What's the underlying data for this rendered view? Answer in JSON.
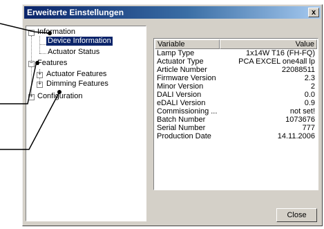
{
  "window": {
    "title": "Erweiterte Einstellungen",
    "close_glyph": "x",
    "close_icon": "close-icon"
  },
  "tree": {
    "information": {
      "label": "Information",
      "expander": "−"
    },
    "device_information": {
      "label": "Device Information",
      "selected": true
    },
    "actuator_status": {
      "label": "Actuator Status"
    },
    "features": {
      "label": "Features",
      "expander": "−"
    },
    "actuator_features": {
      "label": "Actuator Features",
      "expander": "+"
    },
    "dimming_features": {
      "label": "Dimming Features",
      "expander": "+"
    },
    "configuration": {
      "label": "Configuration",
      "expander": "+"
    }
  },
  "table": {
    "columns": [
      "Variable",
      "Value"
    ],
    "rows": [
      [
        "Lamp Type",
        "1x14W T16 (FH-FQ)"
      ],
      [
        "Actuator Type",
        "PCA EXCEL one4all lp"
      ],
      [
        "Article Number",
        "22088511"
      ],
      [
        "Firmware Version",
        "2.3"
      ],
      [
        "Minor Version",
        "2"
      ],
      [
        "DALI Version",
        "0.0"
      ],
      [
        "eDALI Version",
        "0.9"
      ],
      [
        "Commissioning ...",
        "not set!"
      ],
      [
        "Batch Number",
        "1073676"
      ],
      [
        "Serial Number",
        "777"
      ],
      [
        "Production Date",
        "14.11.2006"
      ]
    ]
  },
  "buttons": {
    "close_label": "Close"
  },
  "colors": {
    "titlebar_start": "#0a246a",
    "titlebar_end": "#a6caf0",
    "dialog_face": "#d4d0c8",
    "selection": "#0a246a"
  }
}
